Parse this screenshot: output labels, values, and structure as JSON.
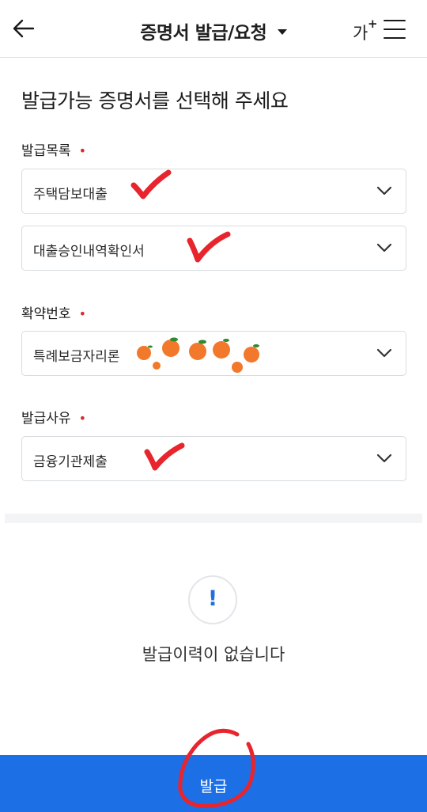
{
  "header": {
    "back_icon": "arrow-left-icon",
    "title": "증명서 발급/요청",
    "title_caret_icon": "caret-down-icon",
    "font_size_label": "가",
    "font_size_plus": "+",
    "menu_icon": "hamburger-icon"
  },
  "main": {
    "heading": "발급가능 증명서를 선택해 주세요",
    "fields": [
      {
        "label": "발급목록",
        "required_mark": "•",
        "selects": [
          {
            "value": "주택담보대출",
            "icon": "chevron-down-icon"
          },
          {
            "value": "대출승인내역확인서",
            "icon": "chevron-down-icon"
          }
        ]
      },
      {
        "label": "확약번호",
        "required_mark": "•",
        "selects": [
          {
            "value": "특례보금자리론",
            "icon": "chevron-down-icon"
          }
        ]
      },
      {
        "label": "발급사유",
        "required_mark": "•",
        "selects": [
          {
            "value": "금융기관제출",
            "icon": "chevron-down-icon"
          }
        ]
      }
    ]
  },
  "history": {
    "icon": "exclamation-circle-icon",
    "icon_glyph": "!",
    "empty_message": "발급이력이 없습니다"
  },
  "footer": {
    "issue_button": "발급"
  },
  "colors": {
    "accent": "#1d6fe6",
    "required": "#d62d2d",
    "annotation": "#e8242c",
    "redaction_orange": "#f2782b"
  }
}
